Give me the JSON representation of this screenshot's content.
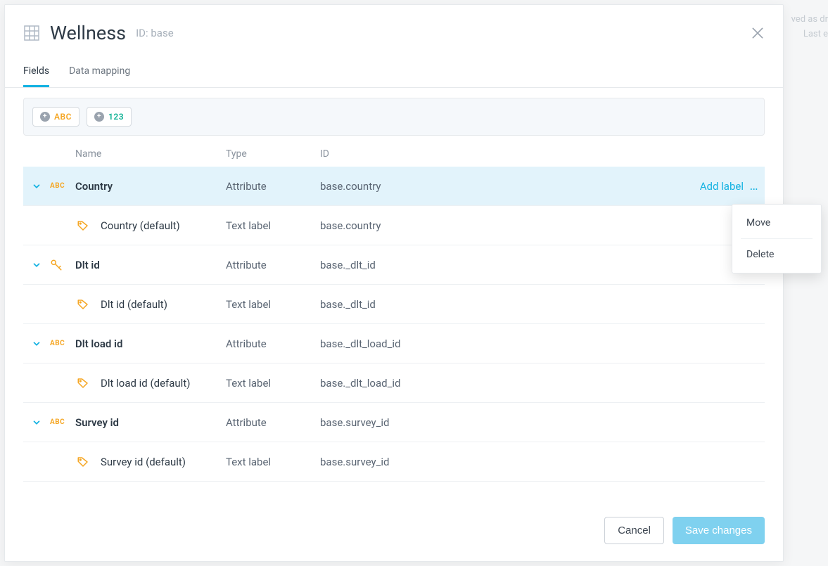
{
  "background": {
    "line1": "ved as dr",
    "line2": "Last e"
  },
  "header": {
    "title": "Wellness",
    "id_label": "ID: base"
  },
  "tabs": {
    "fields": "Fields",
    "data_mapping": "Data mapping"
  },
  "toolbar": {
    "add_abc": "ABC",
    "add_num": "123"
  },
  "columns": {
    "name": "Name",
    "type": "Type",
    "id": "ID"
  },
  "rows": [
    {
      "name": "Country",
      "type": "Attribute",
      "id": "base.country",
      "kind": "abc",
      "highlight": true,
      "action": "Add label"
    },
    {
      "name": "Country (default)",
      "type": "Text label",
      "id": "base.country",
      "kind": "tag",
      "child": true
    },
    {
      "name": "Dlt id",
      "type": "Attribute",
      "id": "base._dlt_id",
      "kind": "key"
    },
    {
      "name": "Dlt id (default)",
      "type": "Text label",
      "id": "base._dlt_id",
      "kind": "tag",
      "child": true
    },
    {
      "name": "Dlt load id",
      "type": "Attribute",
      "id": "base._dlt_load_id",
      "kind": "abc"
    },
    {
      "name": "Dlt load id (default)",
      "type": "Text label",
      "id": "base._dlt_load_id",
      "kind": "tag",
      "child": true
    },
    {
      "name": "Survey id",
      "type": "Attribute",
      "id": "base.survey_id",
      "kind": "abc"
    },
    {
      "name": "Survey id (default)",
      "type": "Text label",
      "id": "base.survey_id",
      "kind": "tag",
      "child": true
    }
  ],
  "menu": {
    "move": "Move",
    "delete": "Delete"
  },
  "footer": {
    "cancel": "Cancel",
    "save": "Save changes"
  }
}
